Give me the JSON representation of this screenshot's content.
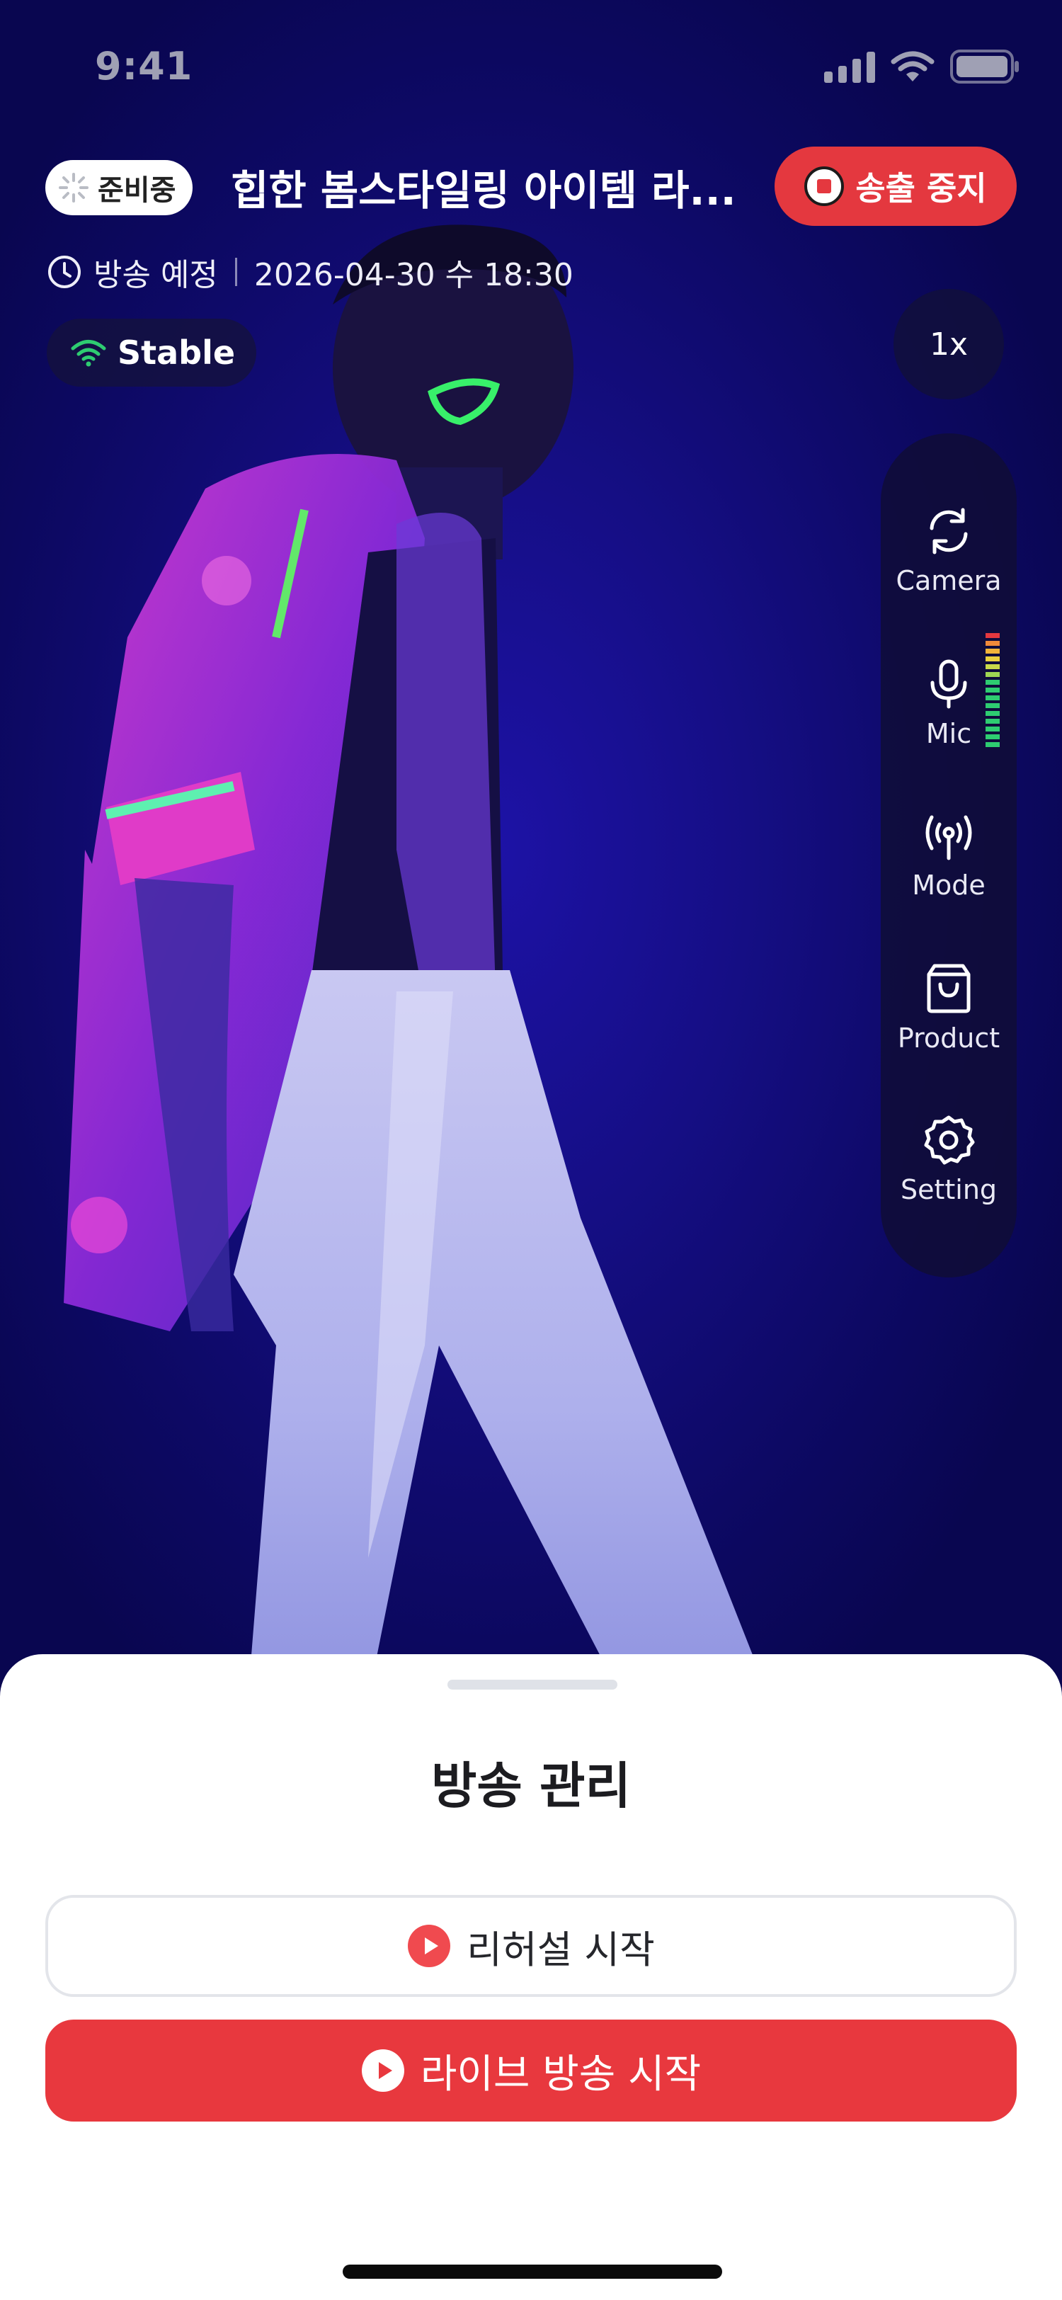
{
  "status_bar": {
    "time": "9:41",
    "icons": [
      "cellular-signal-icon",
      "wifi-icon",
      "battery-icon"
    ]
  },
  "header": {
    "status_chip": "준비중",
    "title": "힙한 봄스타일링 아이템 라...",
    "stop_button": "송출 중지",
    "schedule_label": "방송 예정",
    "schedule_datetime": "2026-04-30 수 18:30",
    "network_status": "Stable"
  },
  "zoom": "1x",
  "tools": [
    {
      "icon": "camera-switch-icon",
      "label": "Camera"
    },
    {
      "icon": "microphone-icon",
      "label": "Mic"
    },
    {
      "icon": "broadcast-icon",
      "label": "Mode"
    },
    {
      "icon": "shopping-bag-icon",
      "label": "Product"
    },
    {
      "icon": "gear-icon",
      "label": "Setting"
    }
  ],
  "sheet": {
    "title": "방송 관리",
    "rehearsal_button": "리허설 시작",
    "live_button": "라이브 방송 시작"
  },
  "colors": {
    "accent_red": "#e8383e",
    "stable_green": "#2ecc71",
    "background_blue": "#150e84"
  }
}
